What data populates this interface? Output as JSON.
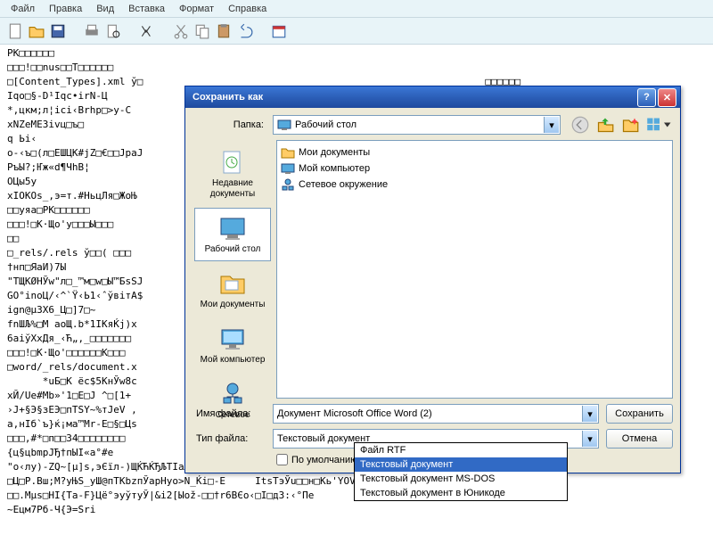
{
  "menu": {
    "file": "Файл",
    "edit": "Правка",
    "view": "Вид",
    "insert": "Вставка",
    "format": "Формат",
    "help": "Справка"
  },
  "garbage_text": "PK□□□□□□\n□□□!□□nus□□T□□□□□□\n□[Content_Types].xml ў□                                                          □□□□□□\nІqо□§-D¹Іqс•іrN-Ц\n*,цкм;л¦ісі‹Вrhp□>у-С\nхNZеМЕЗіvц□ъ□\nq Ьі‹\nо-‹ъ□(л□ЕШЦК#jZ□€□□JpаJ\nРъЫ?;Ҥж«d¶ЧhВ¦\nОЦы5у\nxIОКОs_,э=т.#НьцЛя□ЖоЊ\n□□уяа□PК□□□□□□\n□□□!□К·Що'у□□□Ы□□□\n□□\n□_rels/.rels ў□□( □□□\n†нп□ЯаИ)7Ы\n\"ТЩKØНЎw\"л□_™м□w□Ы™БsSJ\nGO°іnоЦ/‹^`Ÿ‹Ь1‹ˆўвітA$\nіgn@µ3Х6_Ц□]7□~\nfnШЉ%□М аоЩ.b*1ІKяЌј)x\n6aіўXxДя_‹Ћ„,_□□□□□□□\n□□□!□К·Що'□□□□□□К□□□\n□word/_rels/document.x\n      *uБ□К ёс$5КнЎw8с\nхЙ/Uе#Мb»'1□Е□Ј ^□[1+\n›J+§Э§зЕЭ□пТSҮ~%тЈеV ,\nа,нІб`ъ}ќ¡ма™Мr-Е□§□Цs\n□□□,#*□п□□34□□□□□□□□\n{ц§цbmpJЂ†пЫІ«a°#е\n\"о‹лу)-ZQ~[µ]s,эЄїл-)ЩЌЋЌЂЉТІаЉXэ3ЩЌо'°ЎаіҸsK□ А□ІsТ□                       }ЖzcЊIŽU«ф`lQОћ:-s@\n□Ц□Р.Вш;М?уЊЅ_уШ@пТКbzпЎарНуо>N_Ќі□-Е     ІtsТэЎu□□н□Кь'YОVЕ\n□□.Мµs□НІ{Tа-F}Цё°эуўтуЎ|&і2[Ыоž-□□†r6ВЄо‹□I□д3:‹°Пе\n~Ецм7Рб-Ч{Э=Srі",
  "dialog": {
    "title": "Сохранить как",
    "folder_label": "Папка:",
    "folder_value": "Рабочий стол",
    "places": [
      {
        "label": "Недавние документы",
        "sel": false,
        "icon": "recent"
      },
      {
        "label": "Рабочий стол",
        "sel": true,
        "icon": "desktop"
      },
      {
        "label": "Мои документы",
        "sel": false,
        "icon": "docs"
      },
      {
        "label": "Мой компьютер",
        "sel": false,
        "icon": "computer"
      },
      {
        "label": "Сетевое",
        "sel": false,
        "icon": "network"
      }
    ],
    "files": [
      {
        "label": "Мои документы",
        "icon": "folder"
      },
      {
        "label": "Мой компьютер",
        "icon": "computer-sm"
      },
      {
        "label": "Сетевое окружение",
        "icon": "network-sm"
      }
    ],
    "filename_label": "Имя файла:",
    "filename_value": "Документ Microsoft Office Word (2)",
    "filetype_label": "Тип файла:",
    "filetype_value": "Текстовый документ",
    "default_label": "По умолчанию",
    "save_btn": "Сохранить",
    "cancel_btn": "Отмена"
  },
  "dropdown": {
    "items": [
      {
        "label": "Файл RTF",
        "sel": false
      },
      {
        "label": "Текстовый документ",
        "sel": true
      },
      {
        "label": "Текстовый документ MS-DOS",
        "sel": false
      },
      {
        "label": "Текстовый документ в Юникоде",
        "sel": false
      }
    ]
  }
}
